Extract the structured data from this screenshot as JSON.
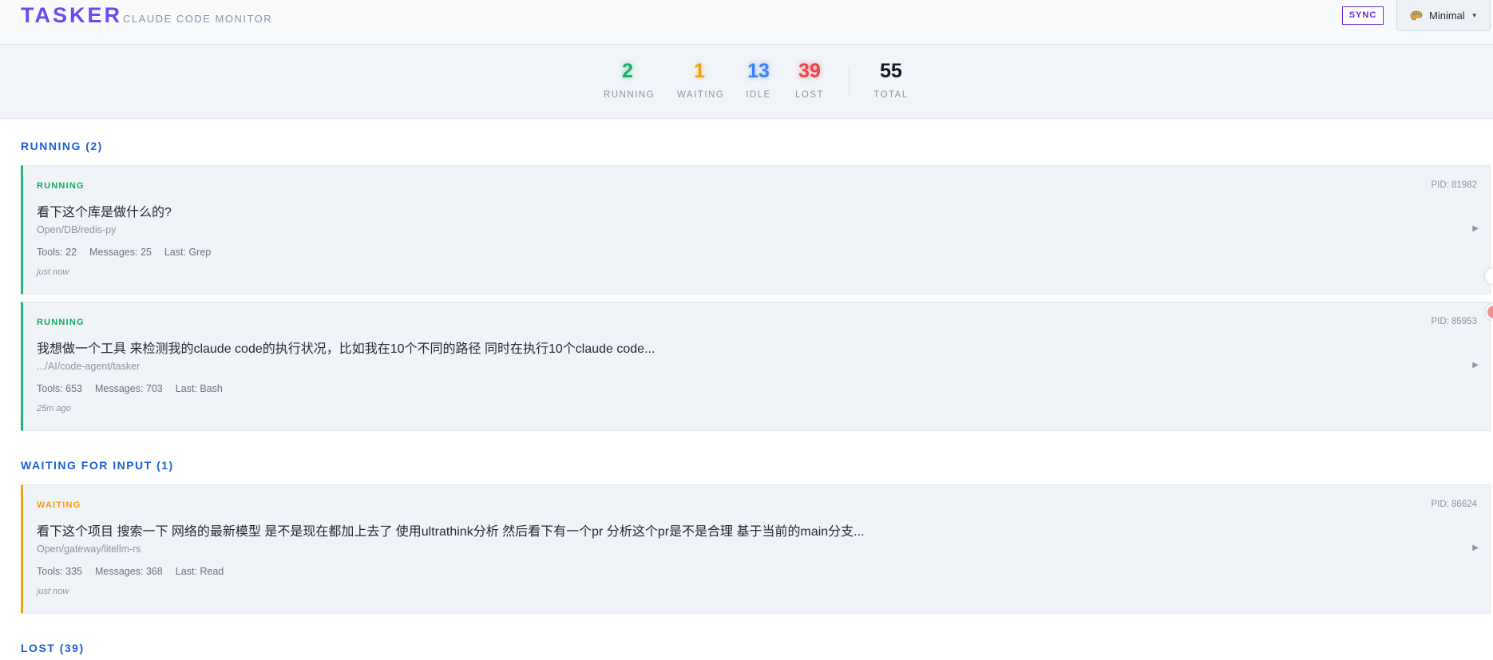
{
  "header": {
    "logo": "TASKER",
    "subtitle": "CLAUDE CODE MONITOR",
    "sync_label": "SYNC",
    "theme_label": "Minimal"
  },
  "stats": {
    "running": {
      "value": "2",
      "label": "RUNNING",
      "color": "#16b36b"
    },
    "waiting": {
      "value": "1",
      "label": "WAITING",
      "color": "#f59e0b"
    },
    "idle": {
      "value": "13",
      "label": "IDLE",
      "color": "#3b82f6"
    },
    "lost": {
      "value": "39",
      "label": "LOST",
      "color": "#ef4444"
    },
    "total": {
      "value": "55",
      "label": "TOTAL",
      "color": "#111827"
    }
  },
  "sections": {
    "running_title": "RUNNING (2)",
    "waiting_title": "WAITING FOR INPUT (1)",
    "lost_title": "LOST (39)"
  },
  "cards": [
    {
      "status": "RUNNING",
      "pid": "PID: 81982",
      "title": "看下这个库是做什么的?",
      "path": "Open/DB/redis-py",
      "tools": "Tools: 22",
      "messages": "Messages: 25",
      "last": "Last: Grep",
      "time": "just now"
    },
    {
      "status": "RUNNING",
      "pid": "PID: 85953",
      "title": "我想做一个工具 来检测我的claude code的执行状况，比如我在10个不同的路径 同时在执行10个claude code...",
      "path": ".../AI/code-agent/tasker",
      "tools": "Tools: 653",
      "messages": "Messages: 703",
      "last": "Last: Bash",
      "time": "25m ago"
    },
    {
      "status": "WAITING",
      "pid": "PID: 86624",
      "title": "看下这个项目 搜索一下 网络的最新模型 是不是现在都加上去了 使用ultrathink分析 然后看下有一个pr 分析这个pr是不是合理 基于当前的main分支...",
      "path": "Open/gateway/litellm-rs",
      "tools": "Tools: 335",
      "messages": "Messages: 368",
      "last": "Last: Read",
      "time": "just now"
    }
  ],
  "colors": {
    "running_accent": "#22b573",
    "waiting_accent": "#f5a20a",
    "section_title": "#1d5fd6",
    "brand": "#6d4aea"
  },
  "icons": {
    "theme": "palette-icon",
    "dropdown": "caret-down-icon",
    "expand": "play-arrow-icon"
  }
}
